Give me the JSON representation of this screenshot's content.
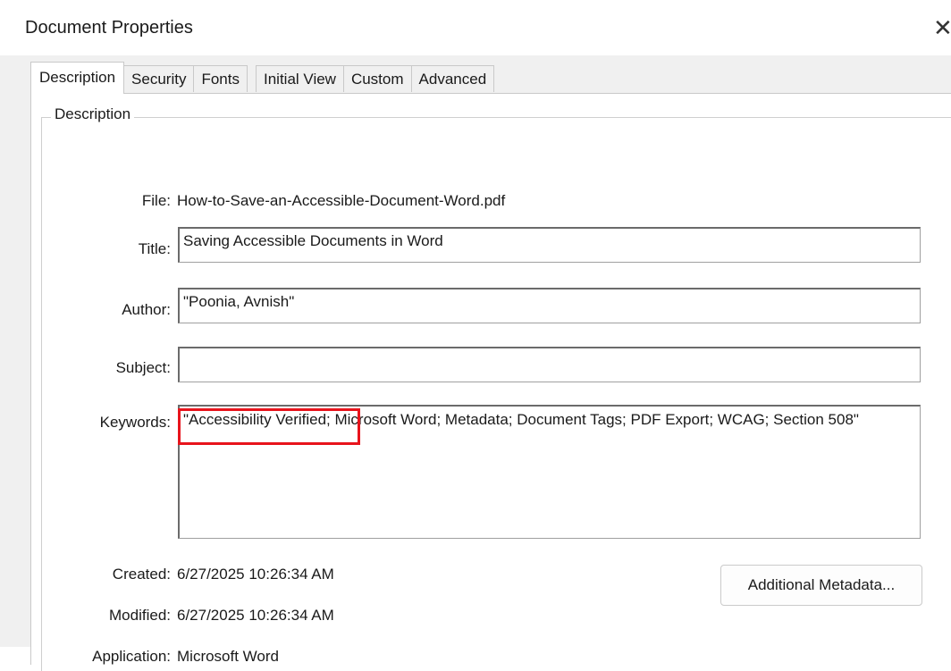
{
  "window": {
    "title": "Document Properties",
    "close_glyph": "✕"
  },
  "tabs": [
    {
      "label": "Description",
      "active": true
    },
    {
      "label": "Security",
      "active": false
    },
    {
      "label": "Fonts",
      "active": false
    },
    {
      "label": "Initial View",
      "active": false
    },
    {
      "label": "Custom",
      "active": false
    },
    {
      "label": "Advanced",
      "active": false
    }
  ],
  "description_group": {
    "legend": "Description",
    "file": {
      "label": "File:",
      "value": "How-to-Save-an-Accessible-Document-Word.pdf"
    },
    "title": {
      "label": "Title:",
      "value": "Saving Accessible Documents in Word"
    },
    "author": {
      "label": "Author:",
      "value": "\"Poonia, Avnish\""
    },
    "subject": {
      "label": "Subject:",
      "value": ""
    },
    "keywords": {
      "label": "Keywords:",
      "value": "\"Accessibility Verified; Microsoft Word; Metadata; Document Tags; PDF Export; WCAG; Section 508\""
    },
    "created": {
      "label": "Created:",
      "value": "6/27/2025 10:26:34 AM"
    },
    "modified": {
      "label": "Modified:",
      "value": "6/27/2025 10:26:34 AM"
    },
    "application": {
      "label": "Application:",
      "value": "Microsoft Word"
    },
    "additional_metadata_button": "Additional Metadata..."
  },
  "colors": {
    "highlight_box": "#e8141c",
    "client_bg": "#f0f0f0",
    "page_bg": "#ffffff"
  }
}
